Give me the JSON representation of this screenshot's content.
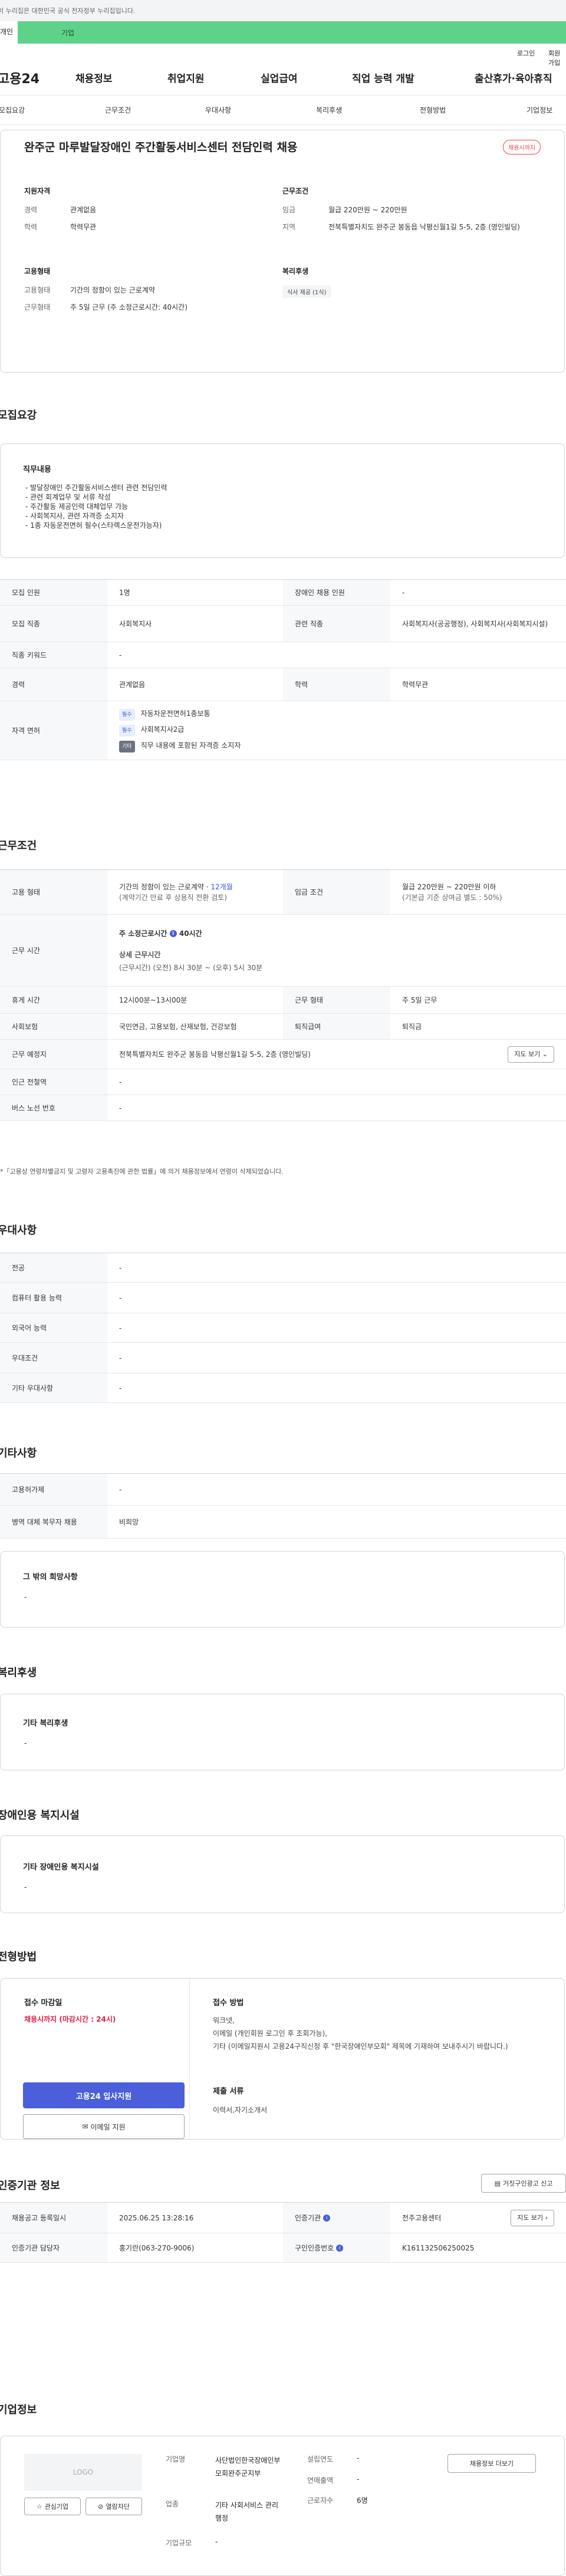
{
  "top_notice": "이 누리집은 대한민국 공식 전자정부 누리집입니다.",
  "user_tabs": {
    "person": "개인",
    "corp": "기업"
  },
  "util": {
    "login": "로그인",
    "join": "회원가입"
  },
  "logo": "고용24",
  "gnb": [
    "채용정보",
    "취업지원",
    "실업급여",
    "직업 능력 개발",
    "출산휴가·육아휴직"
  ],
  "subnav": [
    "모집요강",
    "근무조건",
    "우대사항",
    "복리후생",
    "전형방법",
    "기업정보"
  ],
  "job": {
    "title": "완주군 마루발달장애인 주간활동서비스센터 전담인력 채용",
    "status_badge": "채용시까지",
    "qual_title": "지원자격",
    "qual": [
      {
        "k": "경력",
        "v": "관계없음"
      },
      {
        "k": "학력",
        "v": "학력무관"
      }
    ],
    "cond_title": "근무조건",
    "cond": [
      {
        "k": "임금",
        "v": "월급 220만원 ~ 220만원"
      },
      {
        "k": "지역",
        "v": "전북특별자치도 완주군 봉동읍 낙평신월1길 5-5, 2층 (영인빌딩)"
      }
    ],
    "emp_title": "고용형태",
    "emp": [
      {
        "k": "고용형태",
        "v": "기간의 정함이 있는 근로계약"
      },
      {
        "k": "근무형태",
        "v": "주 5일 근무 (주 소정근로시간: 40시간)"
      }
    ],
    "welfare_title": "복리후생",
    "welfare_chip": "식사 제공 (1식)"
  },
  "recruit": {
    "section_title": "모집요강",
    "duty_title": "직무내용",
    "duties": [
      "- 발달장애인 주간활동서비스센터 관련 전담인력",
      "- 관련 회계업무 및 서류 작성",
      "- 주간활동 제공인력 대체업무 가능",
      "- 사회복지사, 관련 자격증 소지자",
      "- 1종 자동운전면허 필수(스타렉스운전가능자)"
    ],
    "rows": [
      {
        "k1": "모집 인원",
        "v1": "1명",
        "k2": "장애인 채용 인원",
        "v2": "-"
      },
      {
        "k1": "모집 직종",
        "v1": "사회복지사",
        "k2": "관련 직종",
        "v2": "사회복지사(공공행정), 사회복지사(사회복지시설)"
      },
      {
        "k1": "직종 키워드",
        "v1": "-"
      },
      {
        "k1": "경력",
        "v1": "관계없음",
        "k2": "학력",
        "v2": "학력무관"
      }
    ],
    "license_label": "자격 면허",
    "licenses": [
      {
        "tag": "필수",
        "text": "자동차운전면허1종보통"
      },
      {
        "tag": "필수",
        "text": "사회복지사2급"
      },
      {
        "tag": "기타",
        "text": "직무 내용에 포함된 자격증 소지자"
      }
    ]
  },
  "work": {
    "section_title": "근무조건",
    "emp_type_label": "고용 형태",
    "emp_type_value": "기간의 정함이 있는 근로계약 ·",
    "emp_type_months": "12개월",
    "emp_type_note": "(계약기간 만료 후 상용직 전환 검토)",
    "wage_label": "임금 조건",
    "wage_value": "월급 220만원 ~ 220만원 이하",
    "wage_note": "(기본급 기준 상여금 별도 : 50%)",
    "time_label": "근무 시간",
    "time_weekly": "주 소정근로시간",
    "time_weekly_value": "40시간",
    "time_detail_title": "상세 근무시간",
    "time_detail": "(근무시간) (오전) 8시 30분 ~ (오후) 5시 30분",
    "rows": [
      {
        "k1": "휴게 시간",
        "v1": "12시00분~13시00분",
        "k2": "근무 형태",
        "v2": "주 5일 근무"
      },
      {
        "k1": "사회보험",
        "v1": "국민연금, 고용보험, 산재보험, 건강보험",
        "k2": "퇴직급여",
        "v2": "퇴직금"
      }
    ],
    "place_label": "근무 예정지",
    "place_value": "전북특별자치도 완주군 봉동읍 낙평신월1길 5-5, 2층 (영인빌딩)",
    "map_btn": "지도 보기",
    "station_label": "인근 전철역",
    "station_value": "-",
    "bus_label": "버스 노선 번호",
    "bus_value": "-",
    "note": "*「고용상 연령차별금지 및 고령자 고용촉진에 관한 법률」에 의거 채용정보에서 연령이 삭제되었습니다."
  },
  "pref": {
    "section_title": "우대사항",
    "rows": [
      {
        "k": "전공",
        "v": "-"
      },
      {
        "k": "컴퓨터 활용 능력",
        "v": "-"
      },
      {
        "k": "외국어 능력",
        "v": "-"
      },
      {
        "k": "우대조건",
        "v": "-"
      },
      {
        "k": "기타 우대사항",
        "v": "-"
      }
    ]
  },
  "etc": {
    "section_title": "기타사항",
    "rows": [
      {
        "k": "고용허가제",
        "v": "-"
      },
      {
        "k": "병역 대체 복무자 채용",
        "v": "비희망"
      }
    ],
    "hope_title": "그 밖의 희망사항",
    "hope_value": "-"
  },
  "benefit": {
    "section_title": "복리후생",
    "box_title": "기타 복리후생",
    "box_value": "-"
  },
  "facility": {
    "section_title": "장애인용 복지시설",
    "box_title": "기타 장애인용 복지시설",
    "box_value": "-"
  },
  "process": {
    "section_title": "전형방법",
    "deadline_title": "접수 마감일",
    "deadline_value": "채용시까지 (마감시간 : 24시)",
    "apply_btn": "고용24 입사지원",
    "email_btn": "이메일 지원",
    "method_title": "접수 방법",
    "method_text": "워크넷,\n이메일 (개인회원 로그인 후 조회가능),\n기타 (이메일지원시 고용24구직신청 후 \"한국장애인부모회\" 제목에 기재하여 보내주시기 바랍니다.)",
    "docs_title": "제출 서류",
    "docs_value": "이력서,자기소개서"
  },
  "agency": {
    "section_title": "인증기관 정보",
    "report_btn": "거짓구인광고 신고",
    "rows": [
      {
        "k1": "채용공고 등록일시",
        "v1": "2025.06.25 13:28:16",
        "k2": "인증기관",
        "v2": "전주고용센터"
      },
      {
        "k1": "인증기관 담당자",
        "v1": "홍기란(063-270-9006)",
        "k2": "구인인증번호",
        "v2": "K161132506250025"
      }
    ],
    "map_btn": "지도 보기"
  },
  "company": {
    "section_title": "기업정보",
    "logo_placeholder": "LOGO",
    "fav_btn": "관심기업",
    "block_btn": "열람차단",
    "name_label": "기업명",
    "name_value": "사단법인한국장애인부모회완주군지부",
    "industry_label": "업종",
    "industry_value": "기타 사회서비스 관리 행정",
    "size_label": "기업규모",
    "size_value": "-",
    "founded_label": "설립연도",
    "founded_value": "-",
    "sales_label": "연매출액",
    "sales_value": "-",
    "emp_label": "근로자수",
    "emp_value": "6명",
    "more_btn": "채용정보 더보기"
  }
}
